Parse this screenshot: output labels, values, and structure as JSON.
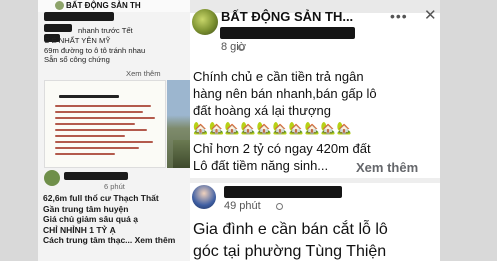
{
  "left_post": {
    "group_name": "BẤT ĐỘNG SẢN TH",
    "text_lines": [
      "nhanh trước Tết",
      "C          Ẻ NHẤT YÊN MỸ",
      "69m đường to ô tô tránh nhau",
      "Sẵn sổ công chứng"
    ],
    "see_more": "Xem thêm",
    "second_time": "6 phút",
    "second_lines": [
      "62,6m full thổ cư Thạch Thất",
      "Gần trung tâm huyện",
      "Giá chủ giảm sâu quá ạ",
      "CHỈ NHỈNH 1 TỶ Ạ",
      "Cách trung tâm thạc... Xem thêm"
    ]
  },
  "right_post": {
    "group_name": "BẤT ĐỘNG SẢN TH...",
    "time": "8 giờ",
    "more_icon": "more-dots-icon",
    "close_icon": "close-icon",
    "body_lines": [
      "Chính chủ e cần tiền trả ngân",
      "hàng nên bán nhanh,bán gấp lô",
      "đất hoàng xá lại thượng"
    ],
    "emoji": "🏡🏡🏡🏡🏡🏡🏡🏡🏡🏡",
    "body_lines_2": [
      "Chỉ hơn 2 tỷ có ngay 420m đất",
      "Lô đất tiềm năng sinh..."
    ],
    "see_more": "Xem thêm",
    "second_time": "49 phút",
    "second_lines": [
      "Gia đình e cần bán cắt lỗ lô",
      "góc tại phường Tùng Thiện"
    ]
  },
  "colors": {
    "redaction": "#151515",
    "see_more": "#65676b",
    "house_emoji": "#b9793a"
  }
}
